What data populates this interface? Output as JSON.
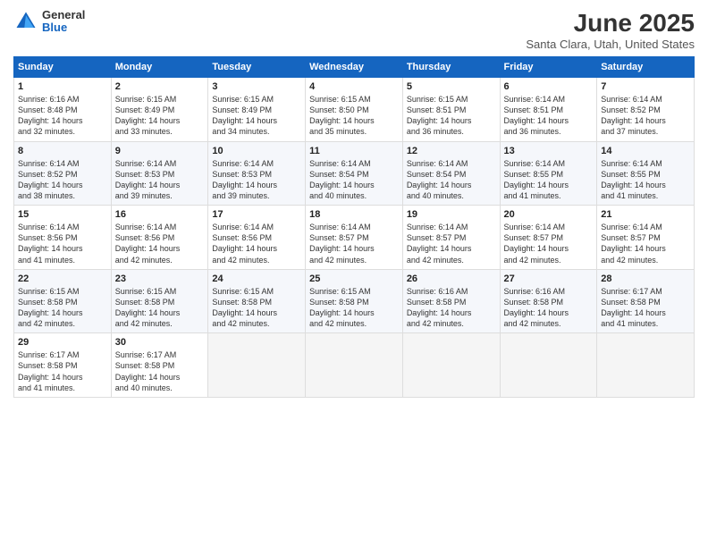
{
  "logo": {
    "general": "General",
    "blue": "Blue"
  },
  "title": "June 2025",
  "subtitle": "Santa Clara, Utah, United States",
  "days_of_week": [
    "Sunday",
    "Monday",
    "Tuesday",
    "Wednesday",
    "Thursday",
    "Friday",
    "Saturday"
  ],
  "weeks": [
    [
      {
        "day": "1",
        "info": "Sunrise: 6:16 AM\nSunset: 8:48 PM\nDaylight: 14 hours\nand 32 minutes."
      },
      {
        "day": "2",
        "info": "Sunrise: 6:15 AM\nSunset: 8:49 PM\nDaylight: 14 hours\nand 33 minutes."
      },
      {
        "day": "3",
        "info": "Sunrise: 6:15 AM\nSunset: 8:49 PM\nDaylight: 14 hours\nand 34 minutes."
      },
      {
        "day": "4",
        "info": "Sunrise: 6:15 AM\nSunset: 8:50 PM\nDaylight: 14 hours\nand 35 minutes."
      },
      {
        "day": "5",
        "info": "Sunrise: 6:15 AM\nSunset: 8:51 PM\nDaylight: 14 hours\nand 36 minutes."
      },
      {
        "day": "6",
        "info": "Sunrise: 6:14 AM\nSunset: 8:51 PM\nDaylight: 14 hours\nand 36 minutes."
      },
      {
        "day": "7",
        "info": "Sunrise: 6:14 AM\nSunset: 8:52 PM\nDaylight: 14 hours\nand 37 minutes."
      }
    ],
    [
      {
        "day": "8",
        "info": "Sunrise: 6:14 AM\nSunset: 8:52 PM\nDaylight: 14 hours\nand 38 minutes."
      },
      {
        "day": "9",
        "info": "Sunrise: 6:14 AM\nSunset: 8:53 PM\nDaylight: 14 hours\nand 39 minutes."
      },
      {
        "day": "10",
        "info": "Sunrise: 6:14 AM\nSunset: 8:53 PM\nDaylight: 14 hours\nand 39 minutes."
      },
      {
        "day": "11",
        "info": "Sunrise: 6:14 AM\nSunset: 8:54 PM\nDaylight: 14 hours\nand 40 minutes."
      },
      {
        "day": "12",
        "info": "Sunrise: 6:14 AM\nSunset: 8:54 PM\nDaylight: 14 hours\nand 40 minutes."
      },
      {
        "day": "13",
        "info": "Sunrise: 6:14 AM\nSunset: 8:55 PM\nDaylight: 14 hours\nand 41 minutes."
      },
      {
        "day": "14",
        "info": "Sunrise: 6:14 AM\nSunset: 8:55 PM\nDaylight: 14 hours\nand 41 minutes."
      }
    ],
    [
      {
        "day": "15",
        "info": "Sunrise: 6:14 AM\nSunset: 8:56 PM\nDaylight: 14 hours\nand 41 minutes."
      },
      {
        "day": "16",
        "info": "Sunrise: 6:14 AM\nSunset: 8:56 PM\nDaylight: 14 hours\nand 42 minutes."
      },
      {
        "day": "17",
        "info": "Sunrise: 6:14 AM\nSunset: 8:56 PM\nDaylight: 14 hours\nand 42 minutes."
      },
      {
        "day": "18",
        "info": "Sunrise: 6:14 AM\nSunset: 8:57 PM\nDaylight: 14 hours\nand 42 minutes."
      },
      {
        "day": "19",
        "info": "Sunrise: 6:14 AM\nSunset: 8:57 PM\nDaylight: 14 hours\nand 42 minutes."
      },
      {
        "day": "20",
        "info": "Sunrise: 6:14 AM\nSunset: 8:57 PM\nDaylight: 14 hours\nand 42 minutes."
      },
      {
        "day": "21",
        "info": "Sunrise: 6:14 AM\nSunset: 8:57 PM\nDaylight: 14 hours\nand 42 minutes."
      }
    ],
    [
      {
        "day": "22",
        "info": "Sunrise: 6:15 AM\nSunset: 8:58 PM\nDaylight: 14 hours\nand 42 minutes."
      },
      {
        "day": "23",
        "info": "Sunrise: 6:15 AM\nSunset: 8:58 PM\nDaylight: 14 hours\nand 42 minutes."
      },
      {
        "day": "24",
        "info": "Sunrise: 6:15 AM\nSunset: 8:58 PM\nDaylight: 14 hours\nand 42 minutes."
      },
      {
        "day": "25",
        "info": "Sunrise: 6:15 AM\nSunset: 8:58 PM\nDaylight: 14 hours\nand 42 minutes."
      },
      {
        "day": "26",
        "info": "Sunrise: 6:16 AM\nSunset: 8:58 PM\nDaylight: 14 hours\nand 42 minutes."
      },
      {
        "day": "27",
        "info": "Sunrise: 6:16 AM\nSunset: 8:58 PM\nDaylight: 14 hours\nand 42 minutes."
      },
      {
        "day": "28",
        "info": "Sunrise: 6:17 AM\nSunset: 8:58 PM\nDaylight: 14 hours\nand 41 minutes."
      }
    ],
    [
      {
        "day": "29",
        "info": "Sunrise: 6:17 AM\nSunset: 8:58 PM\nDaylight: 14 hours\nand 41 minutes."
      },
      {
        "day": "30",
        "info": "Sunrise: 6:17 AM\nSunset: 8:58 PM\nDaylight: 14 hours\nand 40 minutes."
      },
      {
        "day": "",
        "info": ""
      },
      {
        "day": "",
        "info": ""
      },
      {
        "day": "",
        "info": ""
      },
      {
        "day": "",
        "info": ""
      },
      {
        "day": "",
        "info": ""
      }
    ]
  ]
}
